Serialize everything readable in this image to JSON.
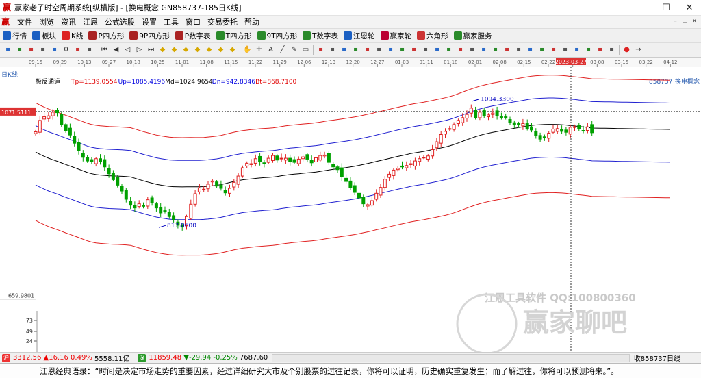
{
  "window": {
    "title": "赢家老子时空周期系统[纵横版] - [换电概念  GN858737-185日K线]",
    "min_icon": "minimize-icon",
    "max_icon": "maximize-icon",
    "close_icon": "close-icon"
  },
  "menu": [
    "文件",
    "浏览",
    "资讯",
    "江恩",
    "公式选股",
    "设置",
    "工具",
    "窗口",
    "交易委托",
    "帮助"
  ],
  "toolbar1": [
    {
      "label": "行情",
      "color": "#1b5fc2"
    },
    {
      "label": "板块",
      "color": "#1b5fc2"
    },
    {
      "label": "K线",
      "color": "#d22"
    },
    {
      "label": "P四方形",
      "color": "#a22"
    },
    {
      "label": "9P四方形",
      "color": "#a22"
    },
    {
      "label": "P数字表",
      "color": "#a22"
    },
    {
      "label": "T四方形",
      "color": "#2a8a2a"
    },
    {
      "label": "9T四方形",
      "color": "#2a8a2a"
    },
    {
      "label": "T数字表",
      "color": "#2a8a2a"
    },
    {
      "label": "江恩轮",
      "color": "#1b5fc2"
    },
    {
      "label": "赢家轮",
      "color": "#b03"
    },
    {
      "label": "六角形",
      "color": "#c33"
    },
    {
      "label": "赢家服务",
      "color": "#2a8a2a"
    }
  ],
  "toolbar2_icons": [
    "grid-icon",
    "tools-icon",
    "chart-icon",
    "layout-icon",
    "calc-icon",
    "zero-icon",
    "sort-icon",
    "bar-icon",
    "first-icon",
    "prev-icon",
    "back-icon",
    "next-icon",
    "last-icon",
    "diamond-icon",
    "diamond-icon",
    "diamond-icon",
    "diamond-icon",
    "diamond-icon",
    "diamond-icon",
    "diamond-icon",
    "hand-icon",
    "cross-icon",
    "text-icon",
    "draw-icon",
    "pen-icon",
    "eraser-icon",
    "grid2-icon",
    "layout2-icon",
    "layout3-icon",
    "cam-icon",
    "cam2-icon",
    "tool-icon",
    "tool2-icon",
    "tool3-icon",
    "tool4-icon",
    "tool5-icon",
    "tool6-icon",
    "tool7-icon",
    "tool8-icon",
    "tool9-icon",
    "tool10-icon",
    "tool11-icon",
    "tool12-icon",
    "tool13-icon",
    "tool14-icon",
    "tool15-icon",
    "tool16-icon",
    "tool17-icon",
    "tool18-icon",
    "tool19-icon",
    "tool20-icon",
    "tool21-icon",
    "color-icon",
    "arrow-icon"
  ],
  "chart_data": {
    "type": "candlestick",
    "period_label": "日K线",
    "indicator_name": "极反通道",
    "indicator_values": [
      {
        "label": "Tp=1139.0554",
        "color": "#e00000"
      },
      {
        "label": "Up=1085.4196",
        "color": "#0000e0"
      },
      {
        "label": "Md=1024.9654",
        "color": "#000000"
      },
      {
        "label": "Dn=942.8346",
        "color": "#0000e0"
      },
      {
        "label": "Bt=868.7100",
        "color": "#e00000"
      }
    ],
    "symbol_code": "858737",
    "symbol_name": "换电概念",
    "x_ticks": [
      "09-15",
      "09-29",
      "10-13",
      "09-27",
      "10-18",
      "10-25",
      "11-01",
      "11-08",
      "11-15",
      "11-22",
      "11-29",
      "12-06",
      "12-13",
      "12-20",
      "12-27",
      "01-03",
      "01-11",
      "01-18",
      "02-01",
      "02-08",
      "02-15",
      "02-22",
      "03-01",
      "03-08",
      "03-15",
      "03-22",
      "04-12",
      "04-19",
      "04-26",
      "05-10"
    ],
    "cursor_date": "2023-03-27",
    "cursor_price": "1071.5111",
    "min_label": "659.9801",
    "annotations": [
      {
        "text": "1094.3300",
        "price": 1094.33,
        "color": "#0000c0"
      },
      {
        "text": "817.0600",
        "price": 817.06,
        "color": "#0000c0"
      }
    ],
    "ylim": [
      640,
      1145
    ],
    "volume_axis_ticks": [
      "73",
      "49",
      "24"
    ],
    "closes": [
      1027,
      1052,
      1060,
      1062,
      1070,
      1069,
      1042,
      1030,
      1020,
      1002,
      985,
      971,
      963,
      961,
      968,
      962,
      950,
      935,
      922,
      910,
      897,
      879,
      866,
      860,
      869,
      864,
      878,
      872,
      860,
      849,
      852,
      841,
      834,
      822,
      818,
      841,
      868,
      891,
      904,
      901,
      912,
      919,
      908,
      903,
      893,
      903,
      916,
      930,
      948,
      958,
      957,
      968,
      961,
      958,
      969,
      975,
      965,
      969,
      969,
      962,
      960,
      967,
      972,
      967,
      959,
      970,
      975,
      976,
      960,
      950,
      944,
      928,
      918,
      904,
      894,
      882,
      869,
      867,
      876,
      892,
      905,
      923,
      934,
      943,
      947,
      950,
      953,
      957,
      963,
      968,
      971,
      974,
      988,
      1005,
      1021,
      1028,
      1034,
      1043,
      1052,
      1058,
      1065,
      1079,
      1058,
      1070,
      1063,
      1064,
      1068,
      1063,
      1058,
      1059,
      1048,
      1042,
      1044,
      1045,
      1034,
      1031,
      1018,
      1011,
      1015,
      1024,
      1033,
      1034,
      1028,
      1026,
      1037,
      1038,
      1033,
      1029,
      1038,
      1025
    ],
    "watermark": [
      "江恩工具软件  QQ:100800360",
      "赢家聊吧",
      "liaoba.yjsh.net"
    ]
  },
  "status_bar": {
    "sh_badge": "沪",
    "sh_index": "3312.56",
    "sh_change": "▲16.16 0.49%",
    "sh_amount": "5558.11亿",
    "sz_badge": "深",
    "sz_index": "11859.48",
    "sz_change": "▼-29.94 -0.25%",
    "sz_amount": "7687.60",
    "right_label": "收858737日线"
  },
  "marquee": "江恩经典语录：“时间是决定市场走势的重要因素，经过详细研究大市及个别股票的过往记录，你将可以证明，历史确实重复发生；而了解过往，你将可以预测将来。”。"
}
